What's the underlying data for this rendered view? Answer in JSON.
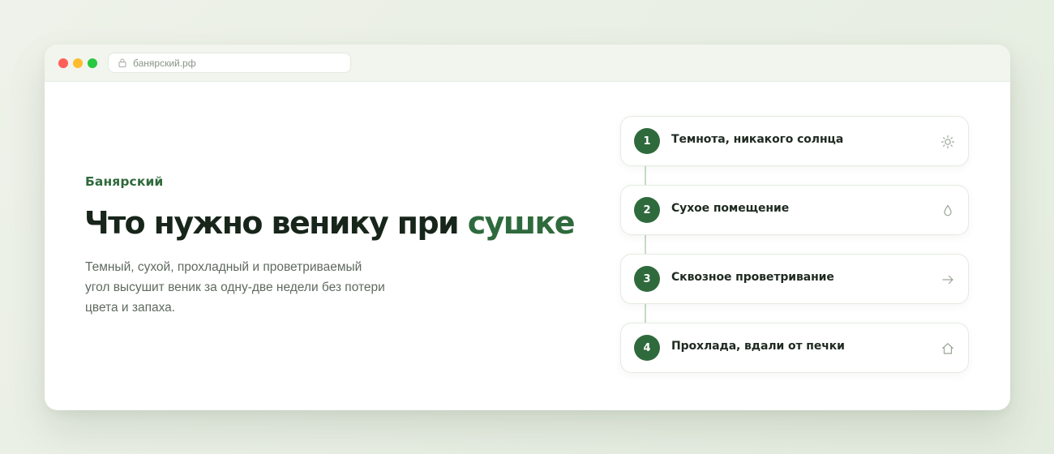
{
  "browser": {
    "url": "банярский.рф"
  },
  "hero": {
    "brand": "Банярский",
    "headline_main": "Что нужно венику при ",
    "headline_accent": "сушке",
    "lead": "Темный, сухой, прохладный и проветриваемый угол высушит веник за одну-две недели без потери цвета и запаха."
  },
  "steps": [
    {
      "number": "1",
      "label": "Темнота, никакого солнца",
      "icon": "sun-icon"
    },
    {
      "number": "2",
      "label": "Сухое помещение",
      "icon": "drop-icon"
    },
    {
      "number": "3",
      "label": "Сквозное проветривание",
      "icon": "arrow-right-icon"
    },
    {
      "number": "4",
      "label": "Прохлада, вдали от печки",
      "icon": "house-icon"
    }
  ],
  "colors": {
    "accent": "#2f6a3c",
    "text": "#17251a",
    "muted": "#5f6a60"
  }
}
